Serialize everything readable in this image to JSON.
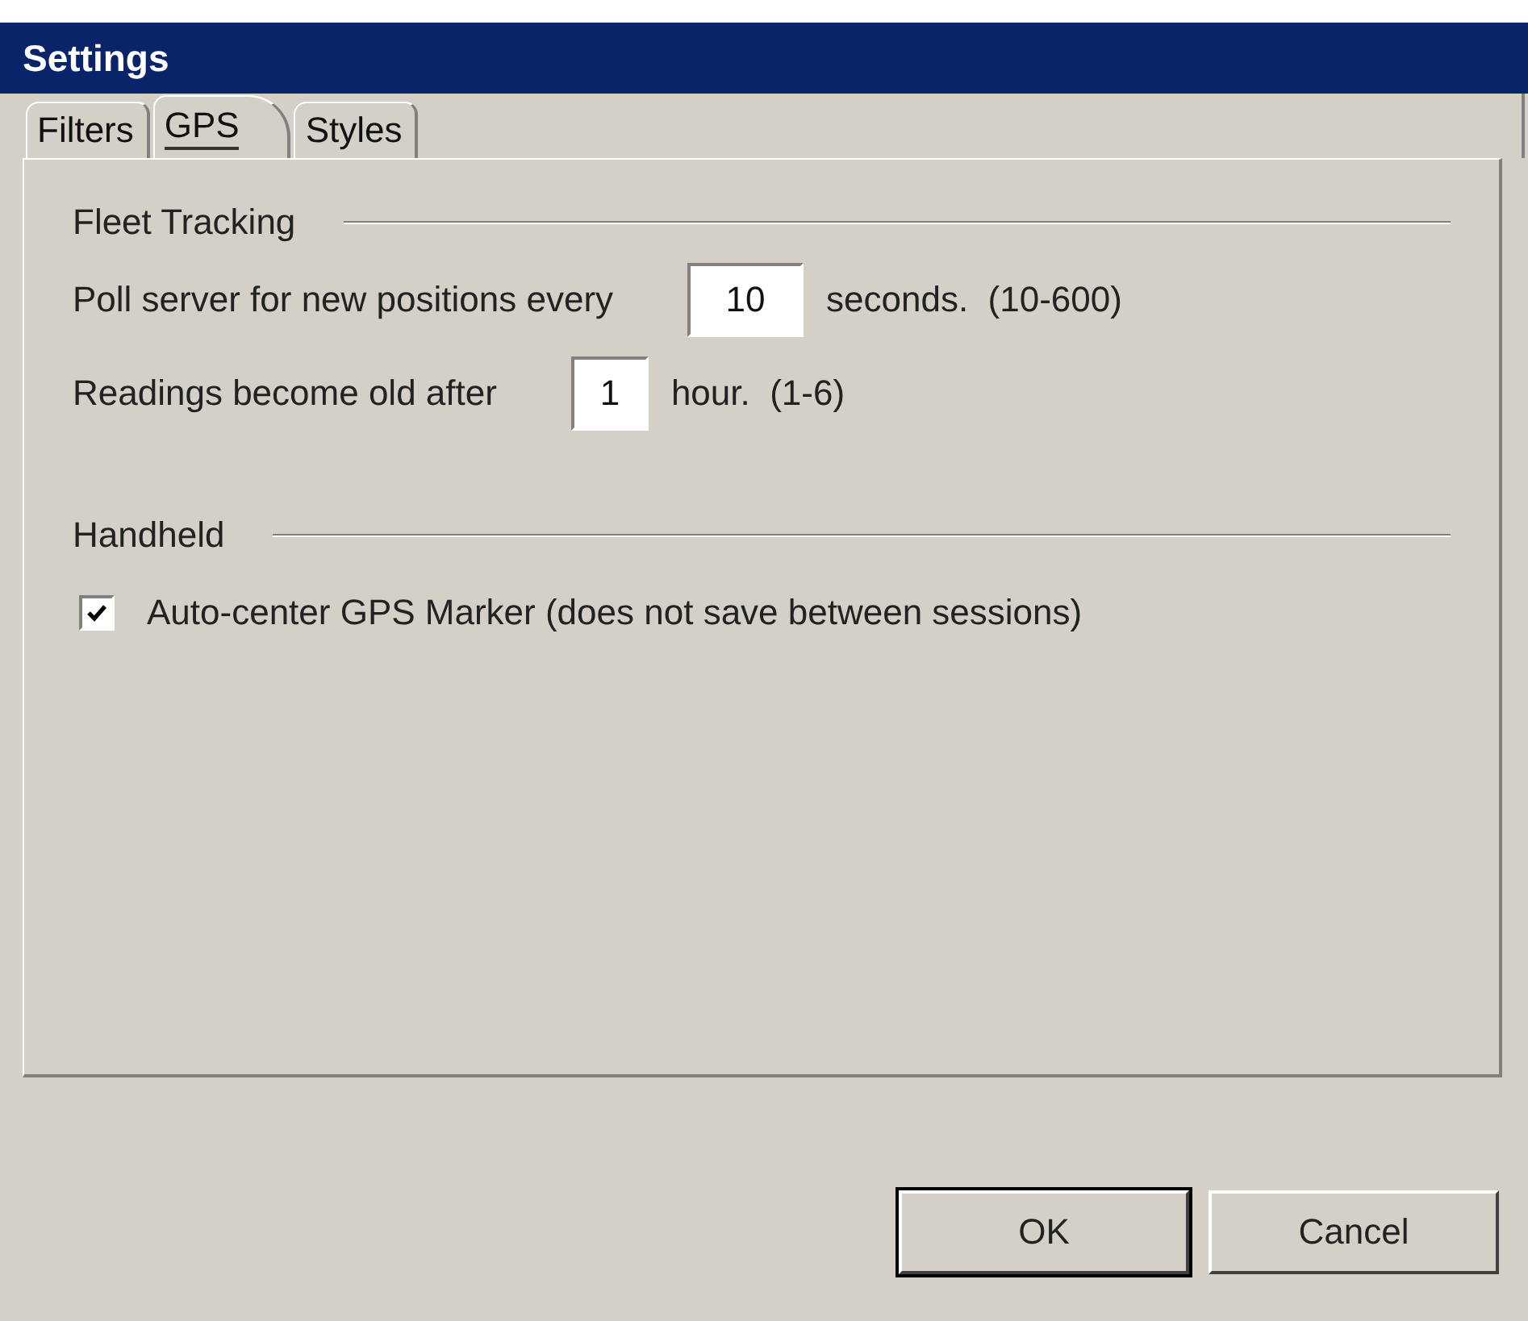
{
  "window": {
    "title": "Settings"
  },
  "tabs": [
    {
      "label": "Filters",
      "selected": false
    },
    {
      "label": "GPS",
      "selected": true
    },
    {
      "label": "Styles",
      "selected": false
    }
  ],
  "groups": [
    {
      "title": "Fleet Tracking",
      "fields": [
        {
          "label": "Poll server for new positions every",
          "value": "10",
          "suffix": "seconds.  (10-600)"
        },
        {
          "label": "Readings become old after",
          "value": "1",
          "suffix": "hour.  (1-6)"
        }
      ]
    },
    {
      "title": "Handheld",
      "checkboxes": [
        {
          "label": "Auto-center GPS Marker (does not save between sessions)",
          "checked": true
        }
      ]
    }
  ],
  "buttons": [
    {
      "label": "OK",
      "default": true
    },
    {
      "label": "Cancel",
      "default": false
    }
  ]
}
